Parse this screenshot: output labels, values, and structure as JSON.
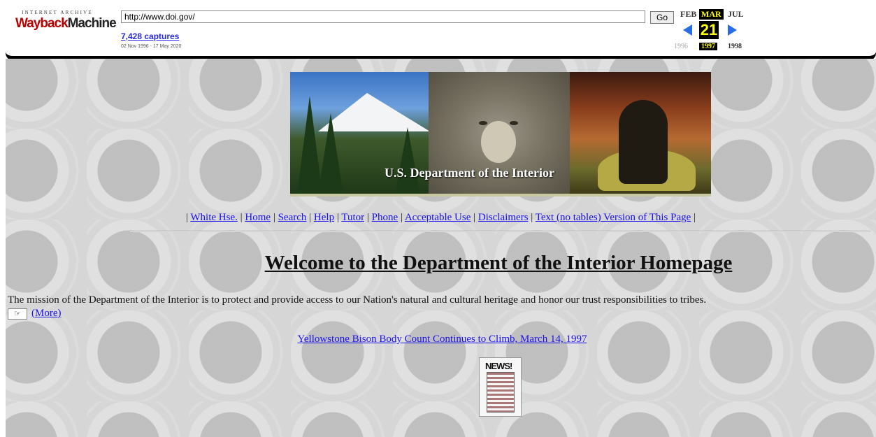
{
  "wayback": {
    "logo_top": "INTERNET ARCHIVE",
    "logo_main_1": "Wayback",
    "logo_main_2": "Machine",
    "url": "http://www.doi.gov/",
    "go_label": "Go",
    "captures": "7,428 captures",
    "date_range": "02 Nov 1996 - 17 May 2020",
    "months": {
      "prev": "FEB",
      "current": "MAR",
      "next": "JUL"
    },
    "day": "21",
    "years": {
      "prev": "1996",
      "current": "1997",
      "next": "1998"
    }
  },
  "banner": {
    "caption": "U.S. Department of the Interior"
  },
  "nav": {
    "links": [
      "White Hse.",
      "Home",
      "Search",
      "Help",
      "Tutor",
      "Phone",
      "Acceptable Use",
      "Disclaimers",
      "Text (no tables) Version of This Page"
    ],
    "separator": "|"
  },
  "main": {
    "heading": "Welcome to the Department of the Interior Homepage",
    "mission": "The mission of the Department of the Interior is to protect and provide access to our Nation's natural and cultural heritage and honor our trust responsibilities to tribes.",
    "more_icon": "pointing-hand-icon",
    "more_label": "(More)",
    "news_link": "Yellowstone Bison Body Count Continues to Climb, March 14, 1997",
    "news_icon_text": "NEWS!"
  },
  "colors": {
    "link": "#1a12ee",
    "wayback_highlight": "#ffff00",
    "wayback_arrow": "#2a6be6",
    "background": "#d6d6d6"
  }
}
